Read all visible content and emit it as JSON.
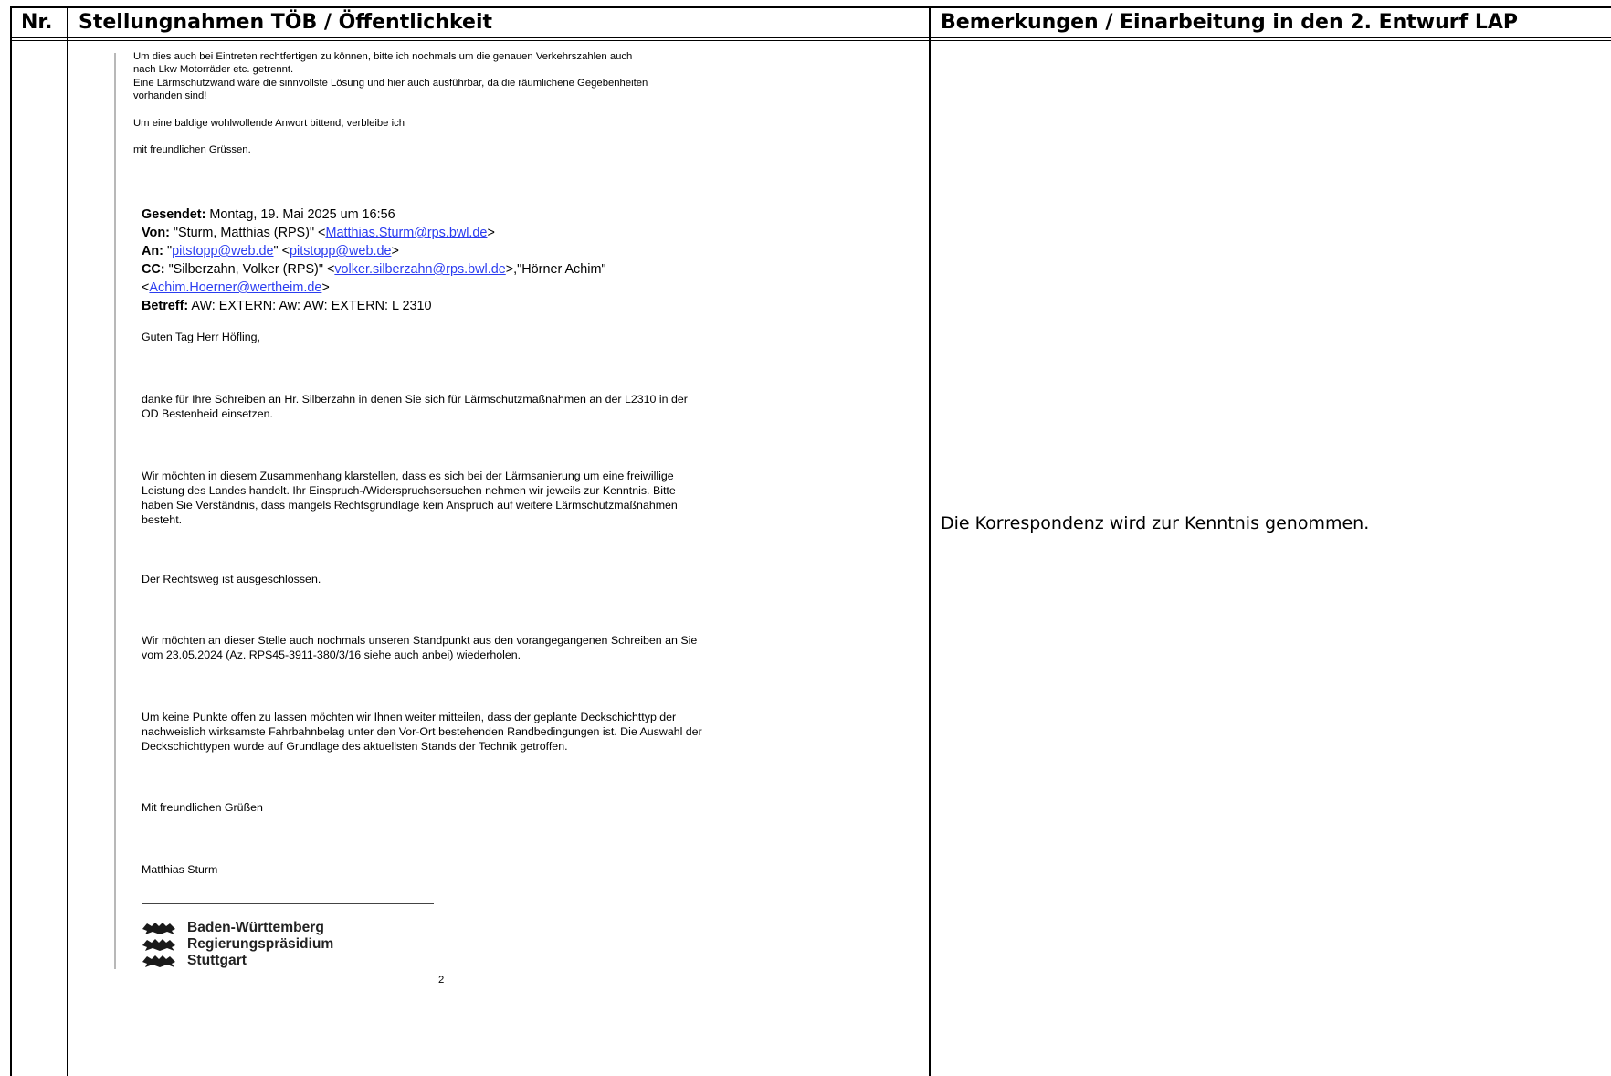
{
  "table": {
    "col_nr": "Nr.",
    "col_statements": "Stellungnahmen TÖB / Öffentlichkeit",
    "col_remarks": "Bemerkungen / Einarbeitung in den 2. Entwurf LAP"
  },
  "quoted": {
    "lines": [
      "Um dies auch bei Eintreten rechtfertigen zu können, bitte ich nochmals um die genauen Verkehrszahlen auch",
      "nach Lkw Motorräder etc. getrennt.",
      "Eine Lärmschutzwand wäre die sinnvollste Lösung und hier auch ausführbar, da die räumlichene Gegebenheiten",
      "vorhanden sind!"
    ],
    "closing_request": "Um eine baldige wohlwollende Anwort bittend, verbleibe ich",
    "regards": "mit freundlichen Grüssen."
  },
  "email": {
    "sent_label": "Gesendet:",
    "sent_value": " Montag, 19. Mai 2025 um 16:56",
    "from_label": "Von:",
    "from_name": " \"Sturm, Matthias (RPS)\" <",
    "from_email": "Matthias.Sturm@rps.bwl.de",
    "from_end": ">",
    "to_label": "An:",
    "to_q1": " \"",
    "to_name_link": "pitstopp@web.de",
    "to_q2": "\" <",
    "to_email": "pitstopp@web.de",
    "to_end": ">",
    "cc_label": "CC:",
    "cc_name": " \"Silberzahn, Volker (RPS)\" <",
    "cc_email": "volker.silberzahn@rps.bwl.de",
    "cc_mid": ">,\"Hörner Achim\"",
    "cc_line2_start": "<",
    "cc_email2": "Achim.Hoerner@wertheim.de",
    "cc_line2_end": ">",
    "subject_label": "Betreff:",
    "subject_value": " AW: EXTERN: Aw: AW: EXTERN: L 2310",
    "greeting": "Guten Tag Herr Höfling,",
    "p1": [
      "danke für Ihre Schreiben an Hr. Silberzahn in denen Sie sich für Lärmschutzmaßnahmen an der L2310 in der",
      "OD Bestenheid einsetzen."
    ],
    "p2": [
      "Wir möchten in diesem Zusammenhang klarstellen, dass es sich bei der Lärmsanierung um eine freiwillige",
      "Leistung des Landes handelt. Ihr Einspruch-/Widerspruchsersuchen nehmen wir jeweils zur Kenntnis. Bitte",
      "haben Sie Verständnis, dass mangels Rechtsgrundlage kein Anspruch auf weitere Lärmschutzmaßnahmen",
      "besteht."
    ],
    "p3": "Der Rechtsweg ist ausgeschlossen.",
    "p4": [
      "Wir möchten an dieser Stelle auch nochmals unseren Standpunkt aus den vorangegangenen Schreiben an Sie",
      "vom 23.05.2024 (Az. RPS45-3911-380/3/16 siehe auch anbei) wiederholen."
    ],
    "p5": [
      "Um keine Punkte offen zu lassen möchten wir Ihnen weiter mitteilen, dass der geplante Deckschichttyp der",
      "nachweislich wirksamste Fahrbahnbelag unter den Vor-Ort bestehenden Randbedingungen ist. Die Auswahl der",
      "Deckschichttypen wurde auf Grundlage des aktuellsten Stands der Technik getroffen."
    ],
    "closing": "Mit freundlichen Grüßen",
    "signature": "Matthias Sturm",
    "logo_lines": [
      "Baden-Württemberg",
      "Regierungspräsidium",
      "Stuttgart"
    ],
    "page_number": "2"
  },
  "remark": "Die Korrespondenz wird zur Kenntnis genommen."
}
